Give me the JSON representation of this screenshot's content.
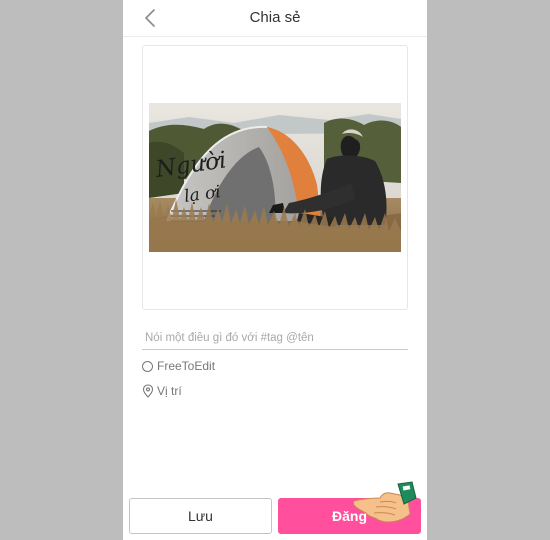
{
  "header": {
    "title": "Chia sẻ",
    "back_icon": "chevron-left-icon"
  },
  "photo": {
    "overlay_text_line1": "Người",
    "overlay_text_line2": "lạ ơi"
  },
  "caption": {
    "placeholder": "Nói một điều gì đó với #tag @tên",
    "value": ""
  },
  "options": {
    "free_to_edit_label": "FreeToEdit",
    "free_to_edit_checked": false,
    "location_label": "Vị trí",
    "location_icon": "map-pin-icon"
  },
  "actions": {
    "save_label": "Lưu",
    "post_label": "Đăng",
    "post_color": "#ff4f9d"
  }
}
